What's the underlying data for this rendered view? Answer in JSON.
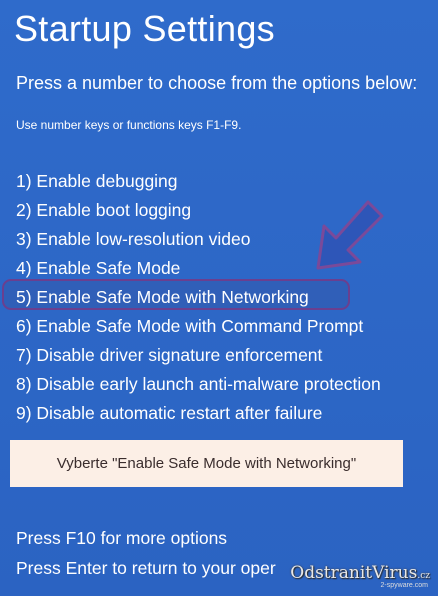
{
  "title": "Startup Settings",
  "subtitle": "Press a number to choose from the options below:",
  "hint": "Use number keys or functions keys F1-F9.",
  "options": [
    "1) Enable debugging",
    "2) Enable boot logging",
    "3) Enable low-resolution video",
    "4) Enable Safe Mode",
    "5) Enable Safe Mode with Networking",
    "6) Enable Safe Mode with Command Prompt",
    "7) Disable driver signature enforcement",
    "8) Disable early launch anti-malware protection",
    "9) Disable automatic restart after failure"
  ],
  "highlighted_option": "5) Enable Safe Mode with Networking",
  "instruction": "Vyberte \"Enable Safe Mode with Networking\"",
  "footer": {
    "more_options": "Press F10 for more options",
    "return": "Press Enter to return to your oper"
  },
  "watermark": {
    "brand": "OdstranitVirus",
    "tld": ".cz",
    "tagline": "2-spyware.com"
  },
  "colors": {
    "background": "#2c66c4",
    "text": "#ffffff",
    "highlight_border": "#6b3f8f",
    "arrow": "#2e56b8",
    "arrow_outline": "#7a4a9a",
    "instruction_bg": "#fcefe6",
    "instruction_text": "#3a2d2d"
  },
  "icons": {
    "arrow": "arrow-down-left-icon"
  }
}
